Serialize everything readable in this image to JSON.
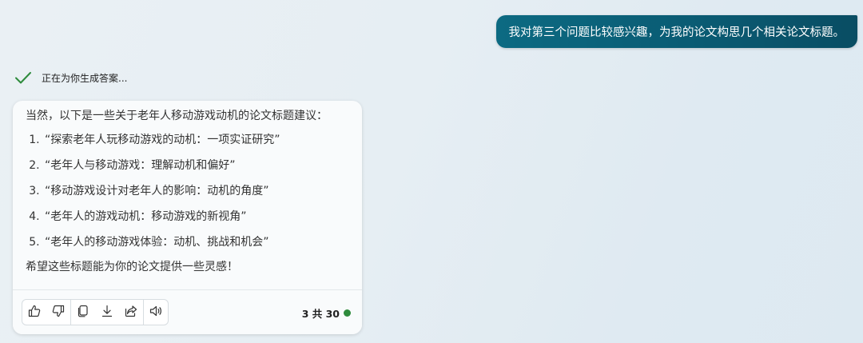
{
  "user_message": "我对第三个问题比较感兴趣，为我的论文构思几个相关论文标题。",
  "status": {
    "text": "正在为你生成答案...",
    "icon": "checkmark-icon",
    "icon_color": "#2e8b3c"
  },
  "response": {
    "intro": "当然，以下是一些关于老年人移动游戏动机的论文标题建议：",
    "items": [
      "“探索老年人玩移动游戏的动机：一项实证研究”",
      "“老年人与移动游戏：理解动机和偏好”",
      "“移动游戏设计对老年人的影响：动机的角度”",
      "“老年人的游戏动机：移动游戏的新视角”",
      "“老年人的移动游戏体验：动机、挑战和机会”"
    ],
    "outro": "希望这些标题能为你的论文提供一些灵感！"
  },
  "toolbar": {
    "buttons": [
      {
        "name": "thumbs-up-icon"
      },
      {
        "name": "thumbs-down-icon"
      },
      {
        "name": "copy-icon"
      },
      {
        "name": "download-icon"
      },
      {
        "name": "share-icon"
      },
      {
        "name": "speaker-icon"
      }
    ]
  },
  "page_count": {
    "text": "3 共 30",
    "dot_color": "#2e8b3c"
  },
  "colors": {
    "user_bubble": "#0a5f77",
    "accent_green": "#2e8b3c"
  }
}
